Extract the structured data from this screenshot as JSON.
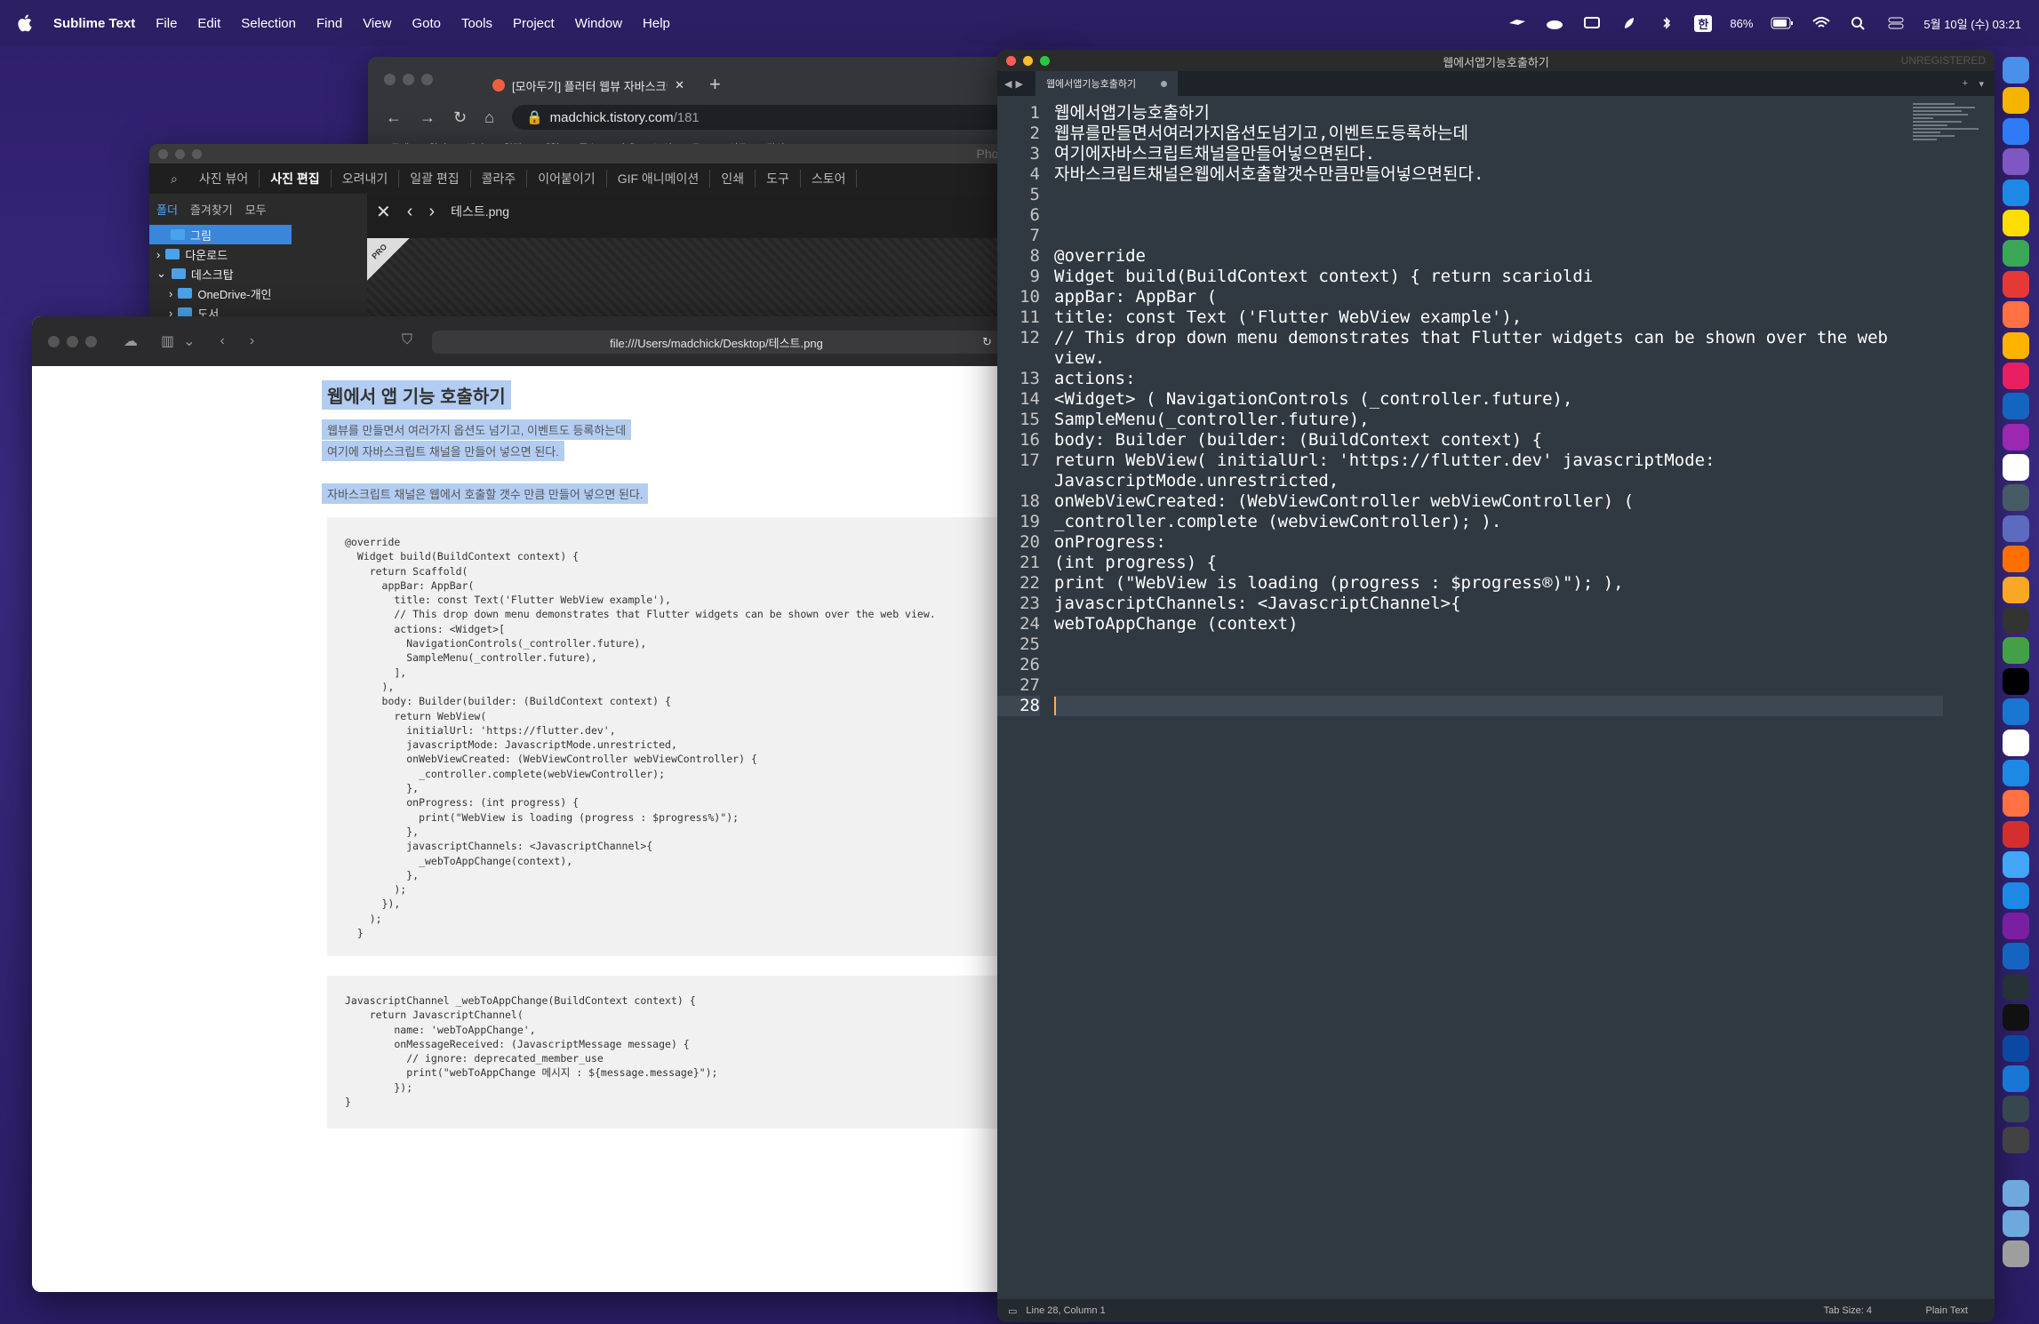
{
  "menubar": {
    "app": "Sublime Text",
    "items": [
      "File",
      "Edit",
      "Selection",
      "Find",
      "View",
      "Goto",
      "Tools",
      "Project",
      "Window",
      "Help"
    ],
    "battery": "86%",
    "ime": "한",
    "datetime": "5월 10일 (수) 03:21"
  },
  "chrome": {
    "tab_title": "[모아두기] 플러터 웹뷰 자바스크립트",
    "url_host": "madchick.tistory.com",
    "url_path": "/181",
    "new_tab": "+",
    "bookmarks": [
      "드레",
      "위키",
      "엔키",
      "일정",
      "메일",
      "주소",
      "카메",
      "노션",
      "로그",
      "이트",
      "강의"
    ]
  },
  "photoscape": {
    "title": "PhotoScape X",
    "menu": [
      "사진 뷰어",
      "사진 편집",
      "오려내기",
      "일괄 편집",
      "콜라주",
      "이어붙이기",
      "GIF 애니메이션",
      "인쇄",
      "도구",
      "스토어"
    ],
    "active_menu": "사진 편집",
    "side_tabs": [
      "폴더",
      "즐겨찾기",
      "모두"
    ],
    "tree": [
      "그림",
      "다운로드",
      "데스크탑",
      "OneDrive-개인",
      "도서"
    ],
    "file": "테스트.png",
    "badge": "PRO"
  },
  "safari": {
    "url": "file:///Users/madchick/Desktop/테스트.png",
    "heading": "웹에서 앱 기능 호출하기",
    "para1": "웹뷰를 만들면서 여러가지 옵션도 넘기고, 이벤트도 등록하는데",
    "para2": "여기에 자바스크립트 채널을 만들어 넣으면 된다.",
    "para3": "자바스크립트 채널은 웹에서 호출할 갯수 만큼 만들어 넣으면 된다.",
    "code1": [
      "@override",
      "  Widget build(BuildContext context) {",
      "    return Scaffold(",
      "      appBar: AppBar(",
      "        title: const Text('Flutter WebView example'),",
      "        // This drop down menu demonstrates that Flutter widgets can be shown over the web view.",
      "        actions: <Widget>[",
      "          NavigationControls(_controller.future),",
      "          SampleMenu(_controller.future),",
      "        ],",
      "      ),",
      "      body: Builder(builder: (BuildContext context) {",
      "        return WebView(",
      "          initialUrl: 'https://flutter.dev',",
      "          javascriptMode: JavascriptMode.unrestricted,",
      "          onWebViewCreated: (WebViewController webViewController) {",
      "            _controller.complete(webViewController);",
      "          },",
      "          onProgress: (int progress) {",
      "            print(\"WebView is loading (progress : $progress%)\");",
      "          },",
      "          javascriptChannels: <JavascriptChannel>{",
      "            _webToAppChange(context),",
      "          },",
      "        );",
      "      }),",
      "    );",
      "  }"
    ],
    "code2": [
      "JavascriptChannel _webToAppChange(BuildContext context) {",
      "    return JavascriptChannel(",
      "        name: 'webToAppChange',",
      "        onMessageReceived: (JavascriptMessage message) {",
      "          // ignore: deprecated_member_use",
      "          print(\"webToAppChange 메시지 : ${message.message}\");",
      "        });",
      "}"
    ]
  },
  "sublime": {
    "title": "웹에서앱기능호출하기",
    "tab": "웹에서앱기능호출하기",
    "unregistered": "UNREGISTERED",
    "lines": [
      {
        "n": "1",
        "text": "웹에서앱기능호출하기"
      },
      {
        "n": "2",
        "text": "웹뷰를만들면서여러가지옵션도넘기고,이벤트도등록하는데"
      },
      {
        "n": "3",
        "text": "여기에자바스크립트채널을만들어넣으면된다."
      },
      {
        "n": "4",
        "text": "자바스크립트채널은웹에서호출할갯수만큼만들어넣으면된다."
      },
      {
        "n": "5",
        "text": ""
      },
      {
        "n": "6",
        "text": ""
      },
      {
        "n": "7",
        "text": ""
      },
      {
        "n": "8",
        "text": "@override"
      },
      {
        "n": "9",
        "text": "Widget build(BuildContext context) { return scarioldi"
      },
      {
        "n": "10",
        "text": "appBar: AppBar ("
      },
      {
        "n": "11",
        "text": "title: const Text ('Flutter WebView example'),"
      },
      {
        "n": "12",
        "text": "// This drop down menu demonstrates that Flutter widgets can be shown over the web view."
      },
      {
        "n": "13",
        "text": "actions:"
      },
      {
        "n": "14",
        "text": "<Widget> ( NavigationControls (_controller.future),"
      },
      {
        "n": "15",
        "text": "SampleMenu(_controller.future),"
      },
      {
        "n": "16",
        "text": "body: Builder (builder: (BuildContext context) {"
      },
      {
        "n": "17",
        "text": "return WebView( initialUrl: 'https://flutter.dev' javascriptMode: JavascriptMode.unrestricted,"
      },
      {
        "n": "18",
        "text": "onWebViewCreated: (WebViewController webViewController) ("
      },
      {
        "n": "19",
        "text": "_controller.complete (webviewController); )."
      },
      {
        "n": "20",
        "text": "onProgress:"
      },
      {
        "n": "21",
        "text": "(int progress) {"
      },
      {
        "n": "22",
        "text": "print (\"WebView is loading (progress : $progress®)\"); ),"
      },
      {
        "n": "23",
        "text": "javascriptChannels: <JavascriptChannel>{"
      },
      {
        "n": "24",
        "text": "webToAppChange (context)"
      },
      {
        "n": "25",
        "text": ""
      },
      {
        "n": "26",
        "text": ""
      },
      {
        "n": "27",
        "text": ""
      },
      {
        "n": "28",
        "text": ""
      }
    ],
    "status_pos": "Line 28, Column 1",
    "tab_size": "Tab Size: 4",
    "syntax": "Plain Text"
  },
  "dock": {
    "colors": [
      "#4a8fe8",
      "#f5b400",
      "#2f7bf5",
      "#7e57c2",
      "#1e88e5",
      "#fddc00",
      "#3aa757",
      "#e53935",
      "#ff7043",
      "#ffb300",
      "#e91e63",
      "#1565c0",
      "#9c27b0",
      "#ffffff",
      "#455a64",
      "#5c6bc0",
      "#ff6f00",
      "#f9a825",
      "#333333",
      "#43a047",
      "#000000",
      "#1976d2",
      "#ffffff",
      "#1e88e5",
      "#ff7043",
      "#d32f2f",
      "#42a5f5",
      "#1e88e5",
      "#7b1fa2",
      "#1565c0",
      "#263238",
      "#111111",
      "#0d47a1",
      "#1976d2",
      "#37474f",
      "#424242",
      "#6fa8dc",
      "#6fa8dc",
      "#9e9e9e"
    ]
  }
}
